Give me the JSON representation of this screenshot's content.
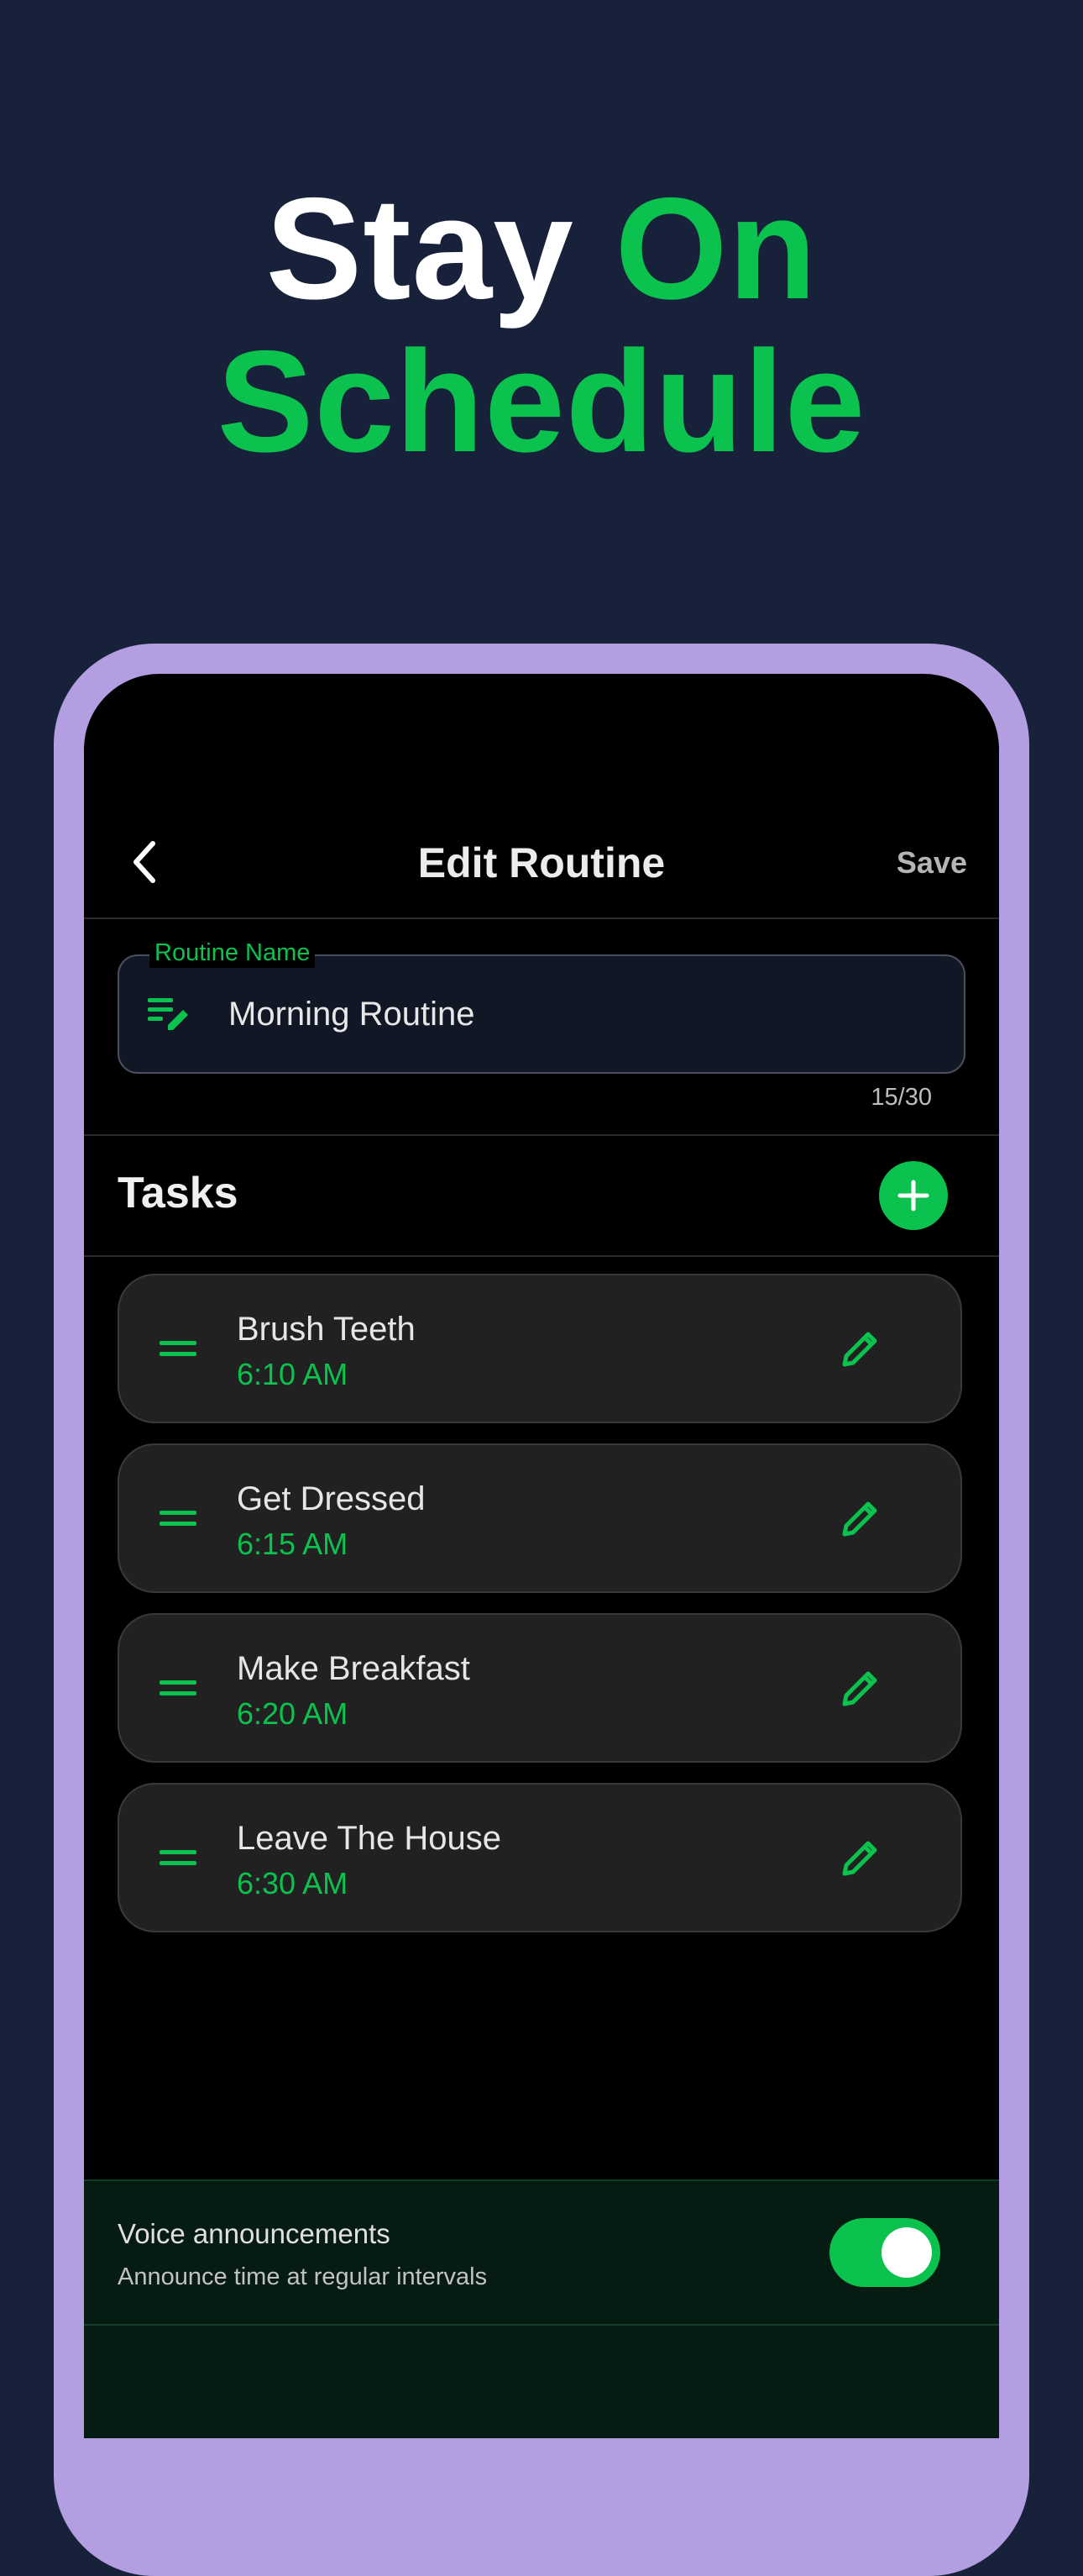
{
  "headline": {
    "word1": "Stay",
    "word2": "On",
    "word3": "Schedule"
  },
  "nav": {
    "title": "Edit Routine",
    "save_label": "Save"
  },
  "routine_field": {
    "label": "Routine Name",
    "value": "Morning Routine",
    "counter": "15/30"
  },
  "tasks": {
    "heading": "Tasks",
    "items": [
      {
        "name": "Brush Teeth",
        "time": "6:10 AM"
      },
      {
        "name": "Get Dressed",
        "time": "6:15 AM"
      },
      {
        "name": "Make Breakfast",
        "time": "6:20 AM"
      },
      {
        "name": "Leave The House",
        "time": "6:30 AM"
      }
    ]
  },
  "voice": {
    "title": "Voice announcements",
    "subtitle": "Announce time at regular intervals",
    "enabled": true
  },
  "colors": {
    "background": "#17223a",
    "accent": "#0cc24f",
    "frame": "#b39ee2",
    "card": "#212121"
  }
}
